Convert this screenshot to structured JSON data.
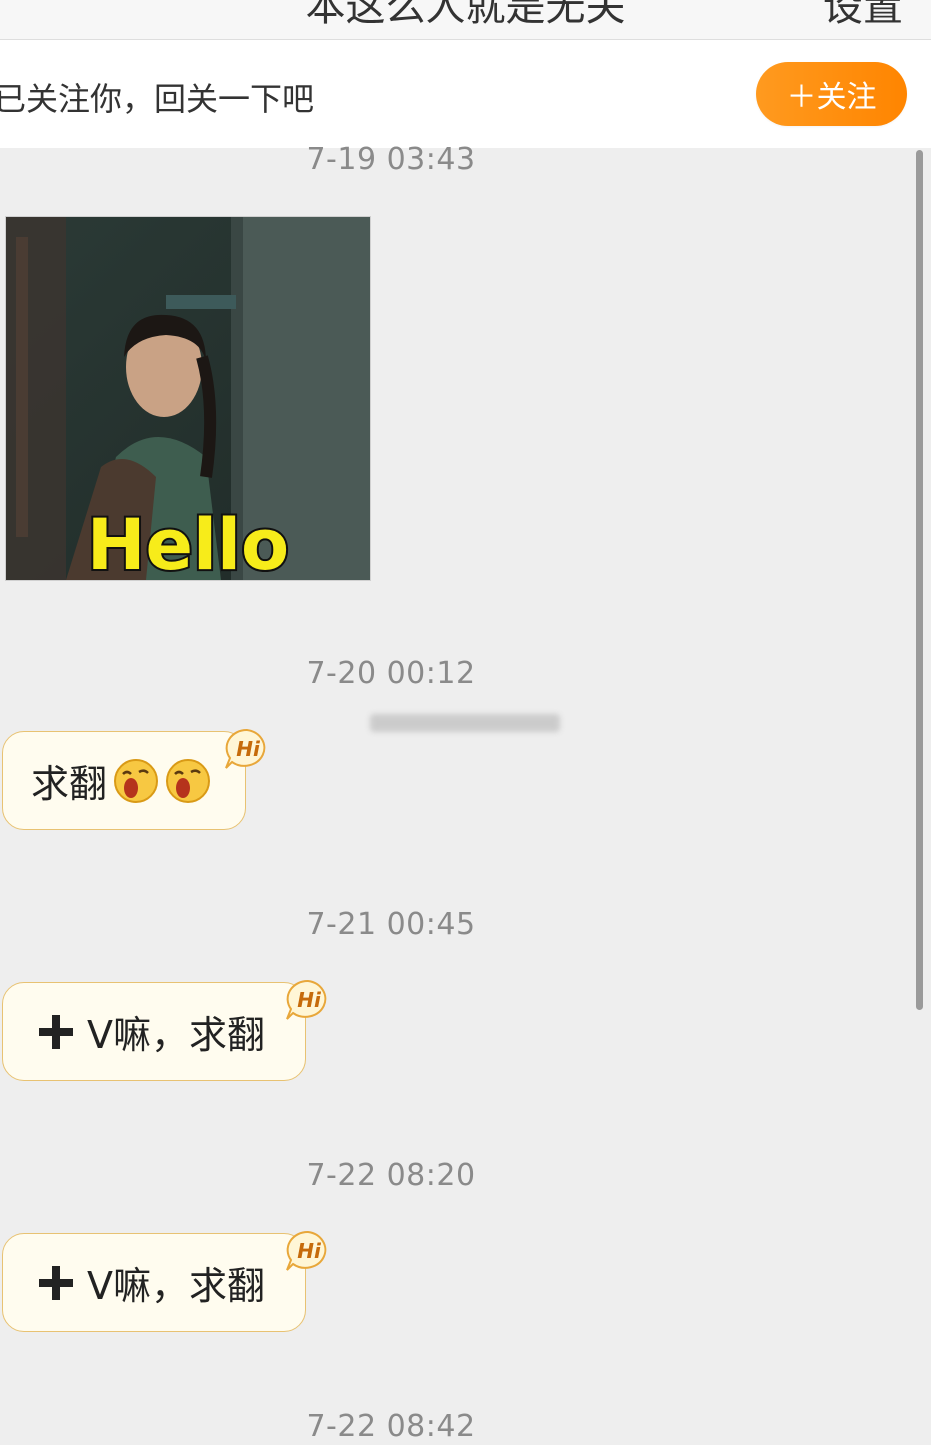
{
  "header": {
    "title": "本这么人就是无关",
    "right_action": "设置"
  },
  "follow_banner": {
    "text": "已关注你，回关一下吧",
    "button_label": "＋关注"
  },
  "messages": [
    {
      "timestamp": "7-19 03:43",
      "type": "image",
      "image_caption": "Hello"
    },
    {
      "timestamp": "7-20 00:12",
      "type": "text",
      "text": "求翻",
      "emoji_count": 2,
      "badge": "Hi"
    },
    {
      "timestamp": "7-21 00:45",
      "type": "text",
      "text": "V嘛，求翻",
      "badge": "Hi"
    },
    {
      "timestamp": "7-22 08:20",
      "type": "text",
      "text": "V嘛，求翻",
      "badge": "Hi"
    },
    {
      "timestamp": "7-22 08:42"
    }
  ],
  "colors": {
    "accent": "#ff8c00",
    "background": "#eeeeee",
    "bubble_fill": "#fffcef",
    "bubble_border": "#e8c272"
  },
  "icons": [
    "plus-icon",
    "crying-emoji-icon",
    "hi-badge-icon"
  ]
}
